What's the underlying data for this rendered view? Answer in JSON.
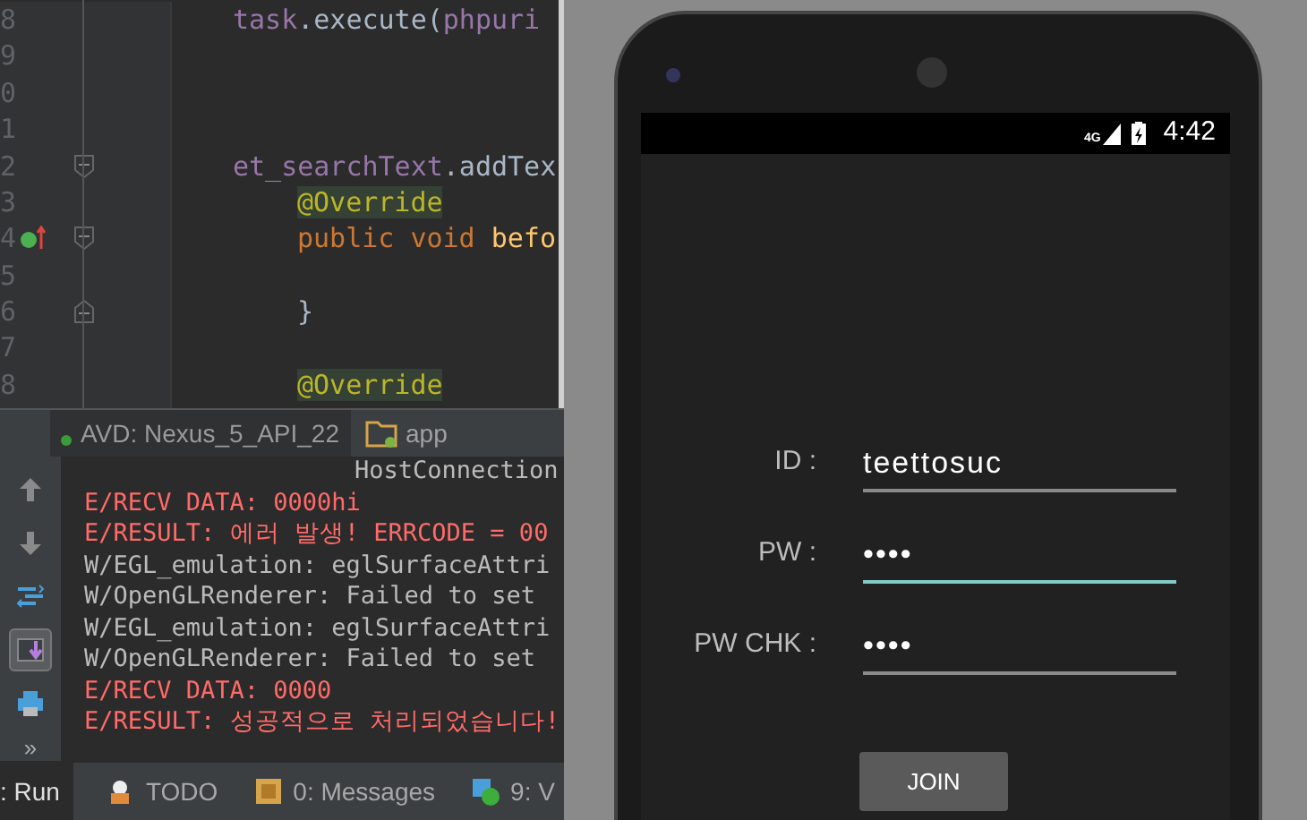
{
  "editor": {
    "lines": [
      {
        "number": "8",
        "tokens": [
          {
            "kind": "field",
            "text": "task"
          },
          {
            "kind": "plain",
            "text": ".execute("
          },
          {
            "kind": "field",
            "text": "phpuri"
          }
        ]
      },
      {
        "number": "9"
      },
      {
        "number": "0"
      },
      {
        "number": "1"
      },
      {
        "number": "2",
        "fold_start": true,
        "tokens": [
          {
            "kind": "field",
            "text": "et_searchText"
          },
          {
            "kind": "plain",
            "text": ".addTex"
          }
        ],
        "children": [
          {
            "number": "3",
            "tokens": [
              {
                "kind": "annotation",
                "text": "@Override"
              }
            ]
          },
          {
            "number": "4",
            "fold_start": true,
            "override_marker": true,
            "tokens": [
              {
                "kind": "keyword",
                "text": "public void "
              },
              {
                "kind": "method",
                "text": "befo"
              }
            ]
          },
          {
            "number": "5"
          },
          {
            "number": "6",
            "fold_end": true,
            "tokens": [
              {
                "kind": "plain",
                "text": "}"
              }
            ]
          },
          {
            "number": "7"
          },
          {
            "number": "8",
            "tokens": [
              {
                "kind": "annotation",
                "text": "@Override"
              }
            ]
          }
        ]
      }
    ]
  },
  "run_tabs": [
    {
      "label": "AVD: Nexus_5_API_22",
      "selected": true
    },
    {
      "label": "app",
      "selected": false
    }
  ],
  "console": {
    "toolbar": [
      {
        "kind": "up"
      },
      {
        "kind": "down"
      },
      {
        "kind": "wrap"
      },
      {
        "kind": "scroll",
        "selected": true
      },
      {
        "kind": "print"
      },
      {
        "kind": "more",
        "text": "»"
      }
    ],
    "lines": [
      {
        "kind": "info",
        "text": "HostConnection"
      },
      {
        "kind": "error",
        "text": "E/RECV DATA: 0000hi"
      },
      {
        "kind": "error",
        "text": "E/RESULT: 에러 발생! ERRCODE = 00"
      },
      {
        "kind": "warning",
        "text": "W/EGL_emulation: eglSurfaceAttri"
      },
      {
        "kind": "warning",
        "text": "W/OpenGLRenderer: Failed to set"
      },
      {
        "kind": "warning",
        "text": "W/EGL_emulation: eglSurfaceAttri"
      },
      {
        "kind": "warning",
        "text": "W/OpenGLRenderer: Failed to set"
      },
      {
        "kind": "error",
        "text": "E/RECV DATA: 0000"
      },
      {
        "kind": "error",
        "text": "E/RESULT: 성공적으로 처리되었습니다!"
      }
    ]
  },
  "bottom_tabs": [
    {
      "kind": "run",
      "label": ": Run",
      "selected": true
    },
    {
      "kind": "todo",
      "label": "TODO",
      "selected": false
    },
    {
      "kind": "messages",
      "label": "0: Messages",
      "selected": false
    },
    {
      "kind": "vcs",
      "label": "9: V",
      "selected": false
    }
  ],
  "phone": {
    "status_bar": {
      "network": "4G",
      "time": "4:42"
    },
    "form": [
      {
        "label": "ID :",
        "value": "teettosuc",
        "focused": false
      },
      {
        "label": "PW :",
        "value": "••••",
        "focused": true
      },
      {
        "label": "PW CHK :",
        "value": "••••",
        "focused": false
      }
    ],
    "button": "JOIN"
  }
}
